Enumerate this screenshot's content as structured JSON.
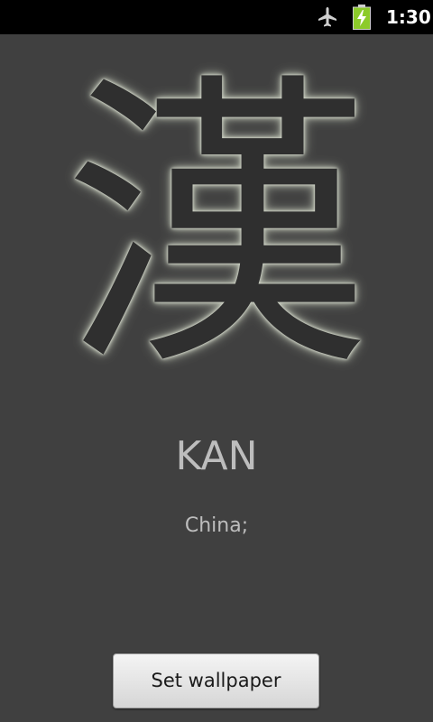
{
  "status_bar": {
    "time": "1:30",
    "icons": [
      "airplane-mode-icon",
      "battery-charging-icon"
    ],
    "battery_color": "#8ccb2a"
  },
  "kanji": {
    "character": "漢",
    "reading": "KAN",
    "meaning": "China;"
  },
  "actions": {
    "set_wallpaper_label": "Set wallpaper"
  }
}
